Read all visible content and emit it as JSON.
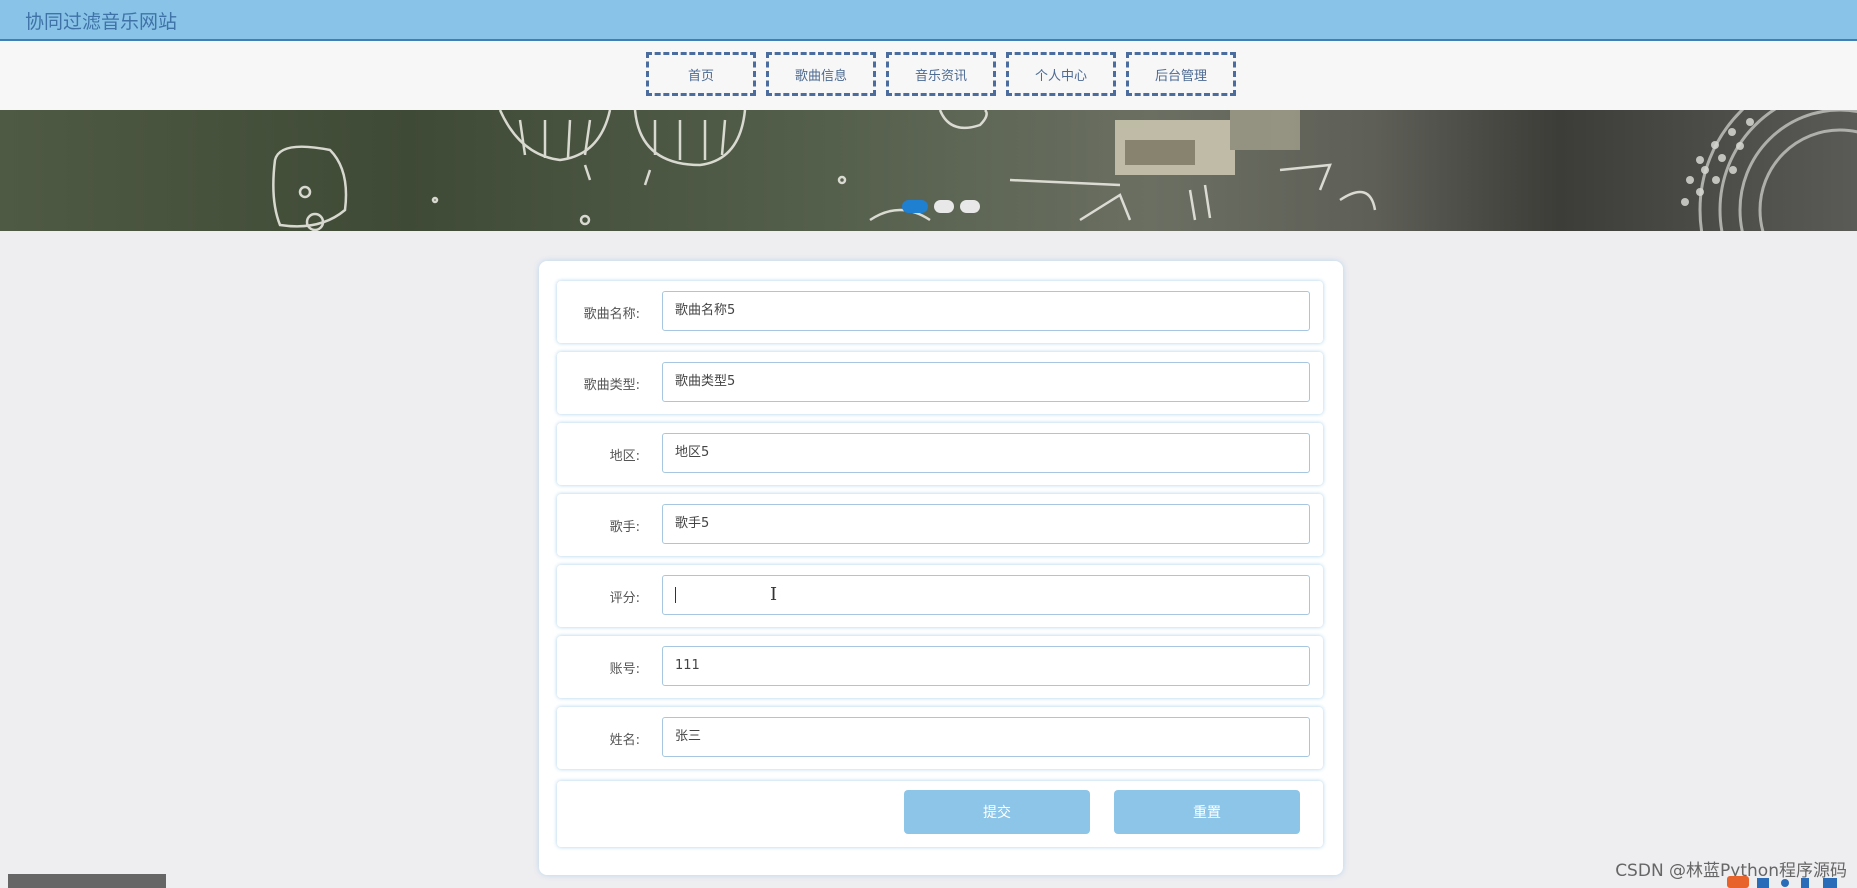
{
  "header": {
    "title": "协同过滤音乐网站"
  },
  "nav": {
    "items": [
      "首页",
      "歌曲信息",
      "音乐资讯",
      "个人中心",
      "后台管理"
    ]
  },
  "carousel": {
    "slide_count": 3,
    "active_index": 0
  },
  "form": {
    "fields": [
      {
        "label": "歌曲名称:",
        "value": "歌曲名称5"
      },
      {
        "label": "歌曲类型:",
        "value": "歌曲类型5"
      },
      {
        "label": "地区:",
        "value": "地区5"
      },
      {
        "label": "歌手:",
        "value": "歌手5"
      },
      {
        "label": "评分:",
        "value": ""
      },
      {
        "label": "账号:",
        "value": "111"
      },
      {
        "label": "姓名:",
        "value": "张三"
      }
    ],
    "submit_label": "提交",
    "reset_label": "重置"
  },
  "watermark": "CSDN @林蓝Python程序源码",
  "colors": {
    "header_bg": "#89c4e8",
    "button_bg": "#8cc5e8",
    "active_dot": "#1f7fd0"
  }
}
